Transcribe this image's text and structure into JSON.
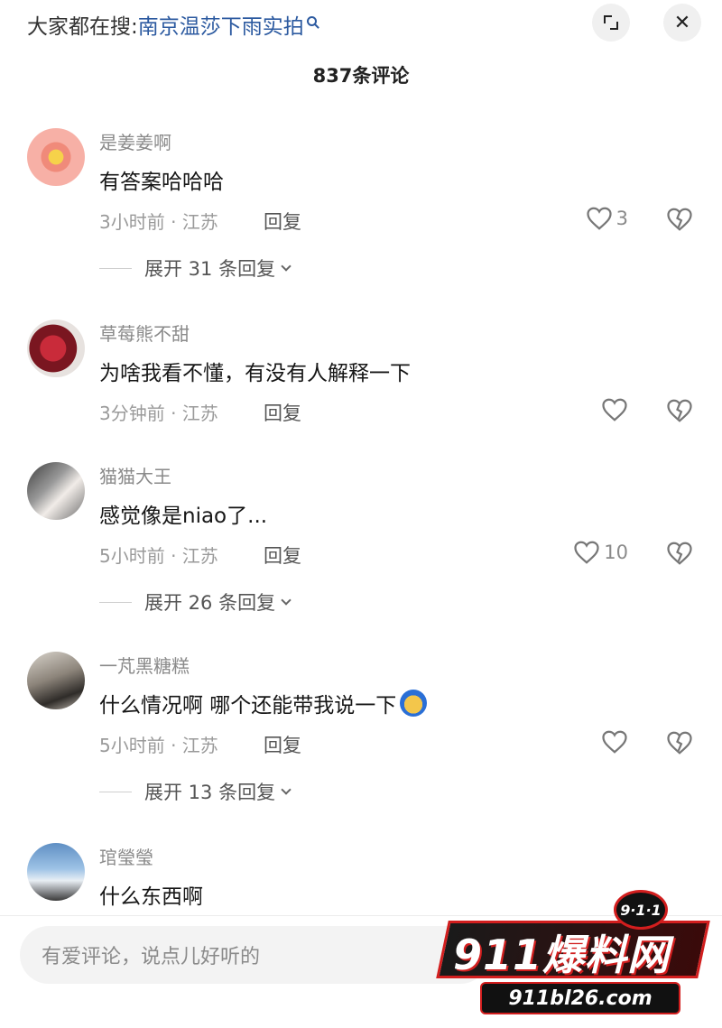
{
  "header": {
    "search_prefix": "大家都在搜:",
    "search_term": "南京温莎下雨实拍",
    "comment_count_label": "837条评论"
  },
  "comments": [
    {
      "username": "是姜姜啊",
      "content": "有答案哈哈哈",
      "meta": "3小时前 · 江苏",
      "reply_label": "回复",
      "like_count": "3",
      "expand_label": "展开 31 条回复",
      "avatar_icon": "sticker-avatar"
    },
    {
      "username": "草莓熊不甜",
      "content": "为啥我看不懂，有没有人解释一下",
      "meta": "3分钟前 · 江苏",
      "reply_label": "回复",
      "like_count": "",
      "avatar_icon": "strawberry-bear-avatar"
    },
    {
      "username": "猫猫大王",
      "content": "感觉像是niao了...",
      "meta": "5小时前 · 江苏",
      "reply_label": "回复",
      "like_count": "10",
      "expand_label": "展开 26 条回复",
      "avatar_icon": "photo-avatar"
    },
    {
      "username": "一芃黑糖糕",
      "content": "什么情况啊 哪个还能带我说一下",
      "meta": "5小时前 · 江苏",
      "reply_label": "回复",
      "like_count": "",
      "expand_label": "展开 13 条回复",
      "avatar_icon": "photo-avatar",
      "emoji_icon": "confused-emoji"
    },
    {
      "username": "琯瑩瑩",
      "content": "什么东西啊",
      "avatar_icon": "seaside-avatar"
    }
  ],
  "input": {
    "placeholder": "有爱评论，说点儿好听的"
  },
  "watermark": {
    "badge": "9·1·1",
    "main": "911爆料网",
    "url": "911bl26.com"
  },
  "colors": {
    "link_blue": "#2c5aa0",
    "watermark_red": "#d21e1e"
  }
}
